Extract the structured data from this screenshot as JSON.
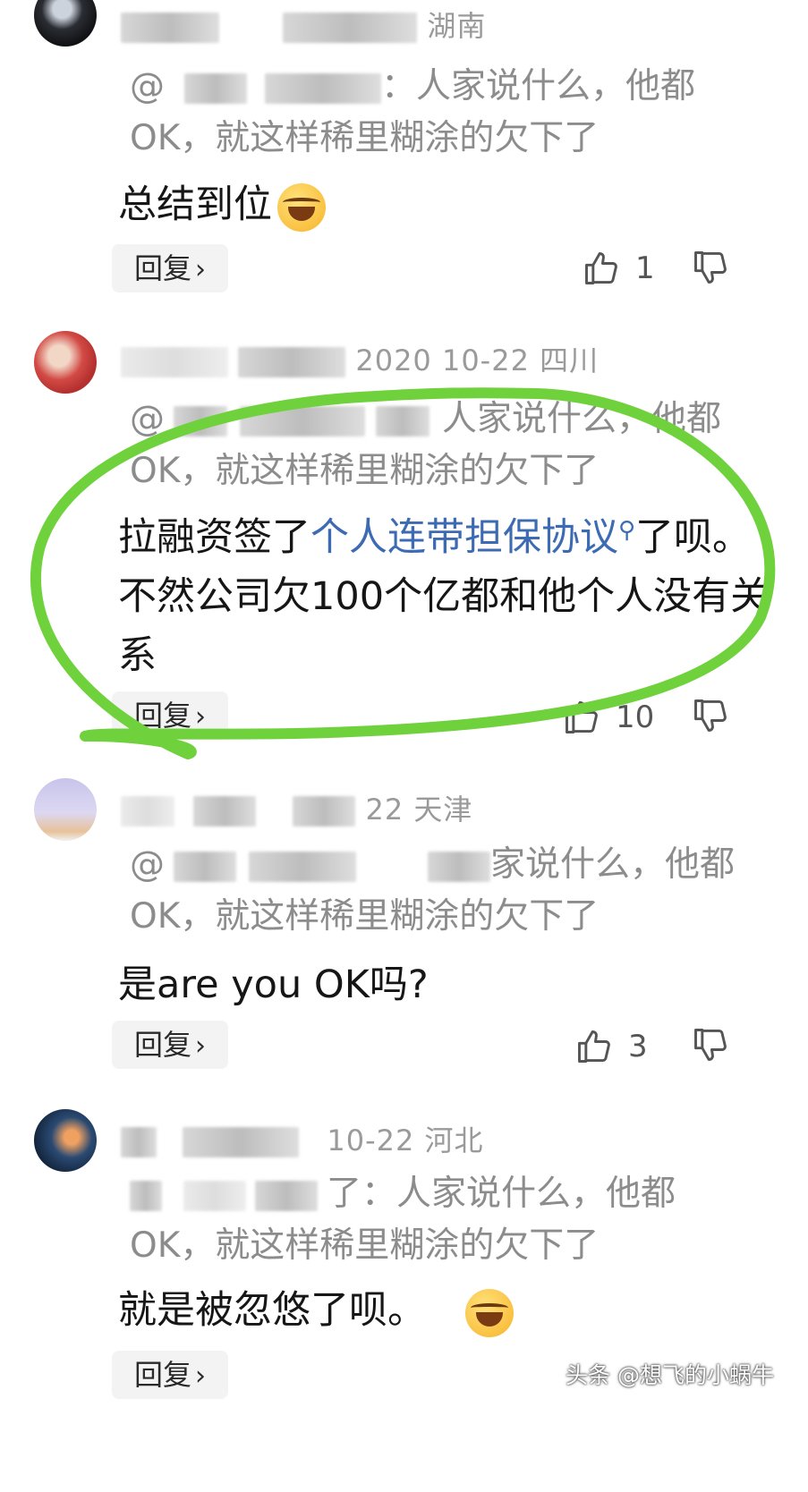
{
  "comments": [
    {
      "meta": "湖南",
      "quote_line1": "：人家说什么，他都",
      "quote_line2": "OK，就这样稀里糊涂的欠下了",
      "body": "总结到位",
      "reply_label": "回复",
      "like_count": "1"
    },
    {
      "meta": "2020  10-22  四川",
      "quote_line1": "人家说什么，他都",
      "quote_line2": "OK，就这样稀里糊涂的欠下了",
      "body_before_link": "拉融资签了",
      "body_link": "个人连带担保协议",
      "body_after_link": "了呗。不然公司欠100个亿都和他个人没有关系",
      "reply_label": "回复",
      "like_count": "10"
    },
    {
      "meta": "22  天津",
      "quote_line1": "家说什么，他都",
      "quote_line2": "OK，就这样稀里糊涂的欠下了",
      "body": "是are you OK吗?",
      "reply_label": "回复",
      "like_count": "3"
    },
    {
      "meta": "10-22  河北",
      "quote_line1": "了：人家说什么，他都",
      "quote_line2": "OK，就这样稀里糊涂的欠下了",
      "body": "就是被忽悠了呗。",
      "reply_label": "回复"
    }
  ],
  "watermark": "头条 @想飞的小蜗牛",
  "colors": {
    "link": "#3d6bb3",
    "annotation": "#6fd13c",
    "muted": "#9a9a9a"
  }
}
